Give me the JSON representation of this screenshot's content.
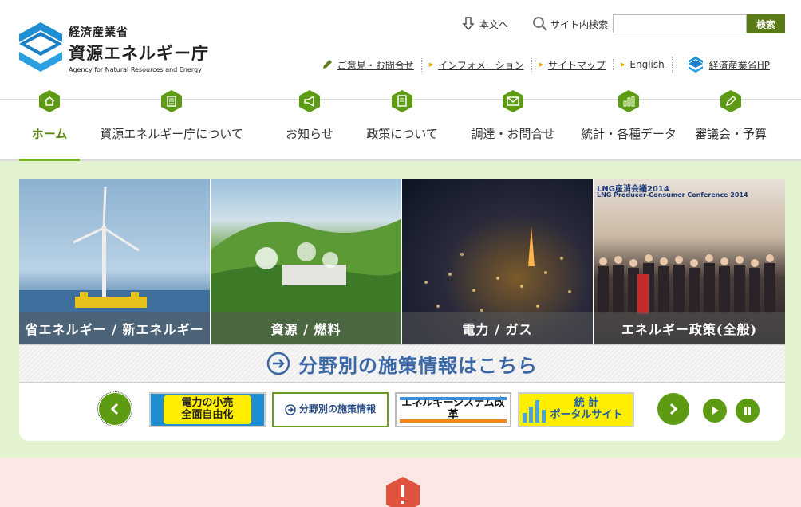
{
  "header": {
    "logo": {
      "sub": "経済産業省",
      "main": "資源エネルギー庁",
      "en": "Agency for Natural Resources and Energy"
    },
    "skip_label": "本文へ",
    "search": {
      "label": "サイト内検索",
      "placeholder": "",
      "button": "検索"
    },
    "links": [
      {
        "label": "ご意見・お問合せ",
        "icon": "pencil-icon"
      },
      {
        "label": "インフォメーション",
        "icon": "triangle-icon"
      },
      {
        "label": "サイトマップ",
        "icon": "triangle-icon"
      },
      {
        "label": "English",
        "icon": "triangle-icon"
      },
      {
        "label": "経済産業省HP",
        "icon": "meti-logo-icon"
      }
    ]
  },
  "nav": [
    {
      "label": "ホーム",
      "icon": "home-icon",
      "active": true
    },
    {
      "label": "資源エネルギー庁について",
      "icon": "building-icon"
    },
    {
      "label": "お知らせ",
      "icon": "megaphone-icon"
    },
    {
      "label": "政策について",
      "icon": "document-icon"
    },
    {
      "label": "調達・お問合せ",
      "icon": "mail-icon"
    },
    {
      "label": "統計・各種データ",
      "icon": "chart-icon"
    },
    {
      "label": "審議会・予算",
      "icon": "pen-icon"
    }
  ],
  "feature": {
    "photos": [
      {
        "caption": "省エネルギー / 新エネルギー"
      },
      {
        "caption": "資源 / 燃料"
      },
      {
        "caption": "電力 / ガス"
      },
      {
        "caption": "エネルギー政策(全般)",
        "overlay_1": "LNG産消会議2014",
        "overlay_2": "LNG Producer-Consumer Conference 2014"
      }
    ],
    "bar_text": "分野別の施策情報はこちら",
    "banners": [
      {
        "line1": "電力の小売",
        "line2": "全面自由化"
      },
      {
        "label": "分野別の施策情報"
      },
      {
        "label": "エネルギーシステム改革"
      },
      {
        "line1": "統 計",
        "line2": "ポータルサイト"
      }
    ]
  },
  "colors": {
    "accent_green": "#5c9b12",
    "nav_active": "#7ab51d",
    "main_bg": "#e4f3cf",
    "alert_bg": "#fde7e5",
    "alert_red": "#e0533f",
    "link_blue": "#3a67a6"
  }
}
